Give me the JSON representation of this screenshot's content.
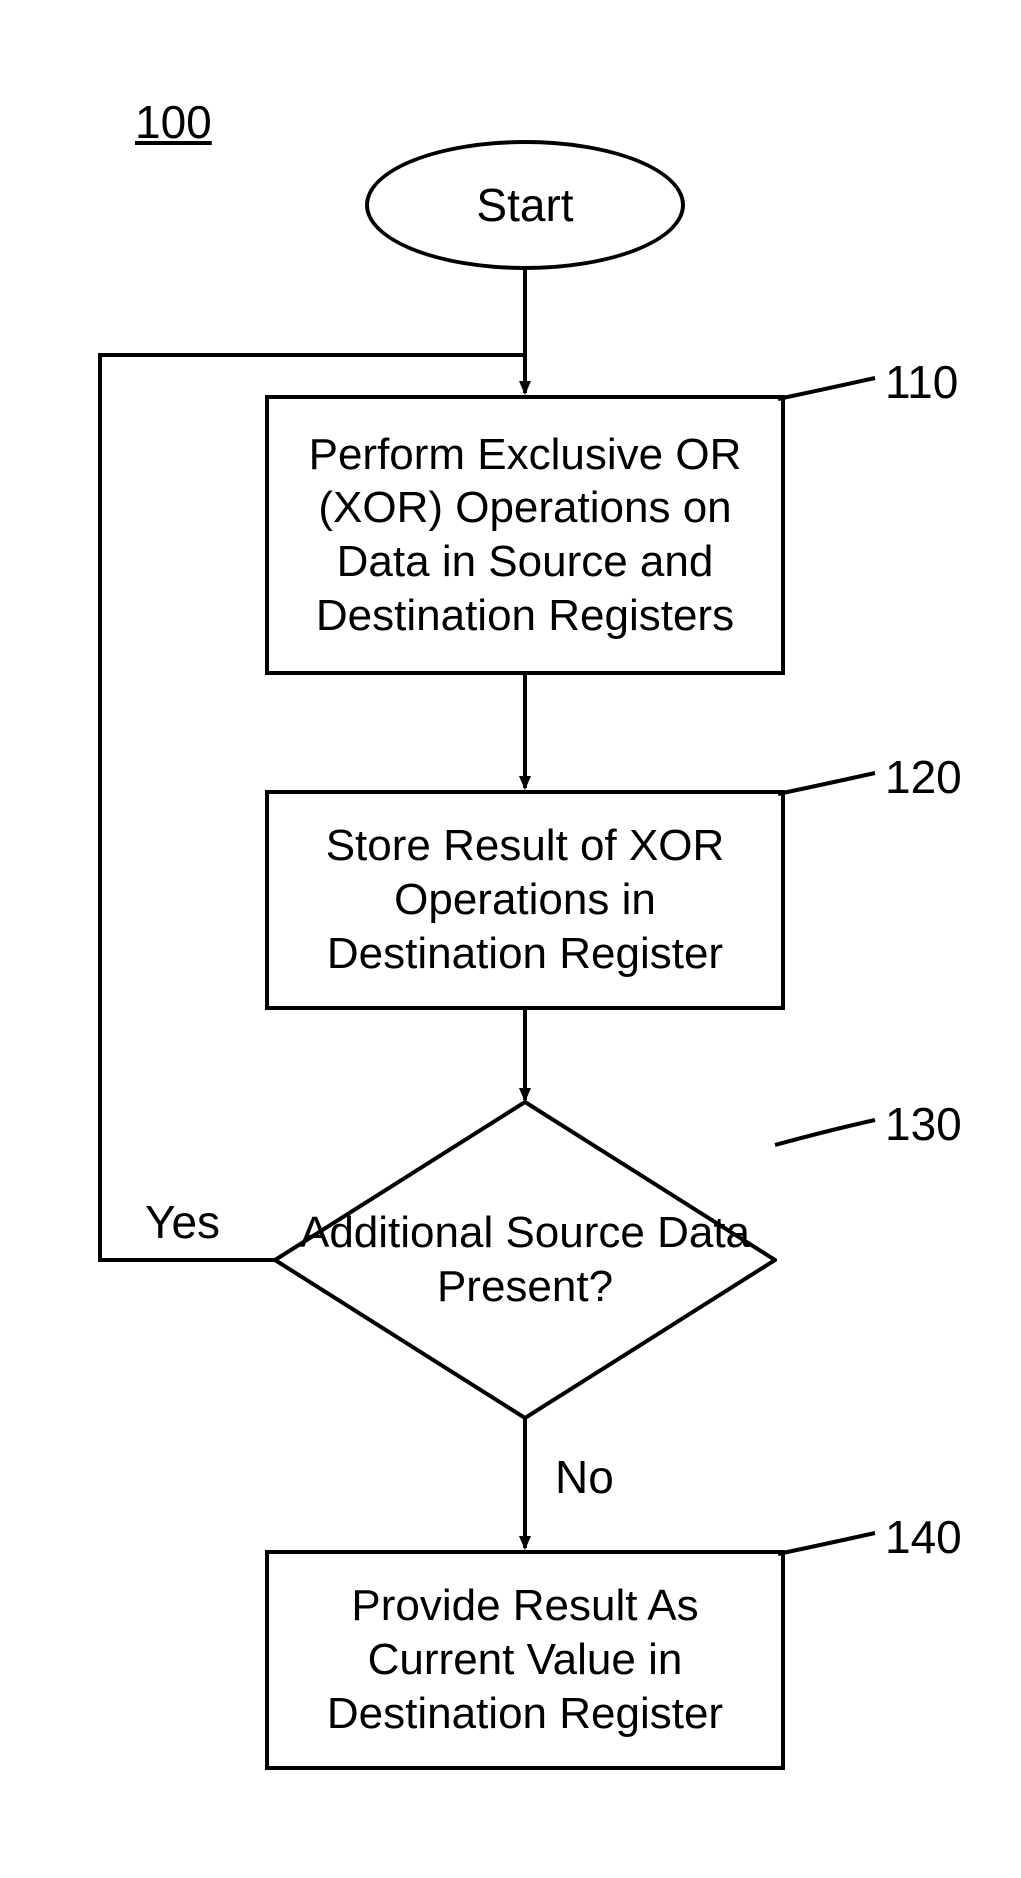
{
  "figure_id": "100",
  "nodes": {
    "start": {
      "label": "Start"
    },
    "step110": {
      "ref": "110",
      "text": "Perform Exclusive OR (XOR) Operations on Data in Source and Destination Registers"
    },
    "step120": {
      "ref": "120",
      "text": "Store Result of XOR Operations in Destination Register"
    },
    "decision130": {
      "ref": "130",
      "text": "Additional Source Data Present?"
    },
    "step140": {
      "ref": "140",
      "text": "Provide Result As Current Value in Destination Register"
    }
  },
  "edges": {
    "yes": "Yes",
    "no": "No"
  },
  "chart_data": {
    "type": "flowchart",
    "nodes": [
      {
        "id": "start",
        "kind": "terminator",
        "label": "Start"
      },
      {
        "id": "110",
        "kind": "process",
        "label": "Perform Exclusive OR (XOR) Operations on Data in Source and Destination Registers"
      },
      {
        "id": "120",
        "kind": "process",
        "label": "Store Result of XOR Operations in Destination Register"
      },
      {
        "id": "130",
        "kind": "decision",
        "label": "Additional Source Data Present?"
      },
      {
        "id": "140",
        "kind": "process",
        "label": "Provide Result As Current Value in Destination Register"
      }
    ],
    "edges": [
      {
        "from": "start",
        "to": "110"
      },
      {
        "from": "110",
        "to": "120"
      },
      {
        "from": "120",
        "to": "130"
      },
      {
        "from": "130",
        "to": "110",
        "label": "Yes"
      },
      {
        "from": "130",
        "to": "140",
        "label": "No"
      }
    ]
  }
}
